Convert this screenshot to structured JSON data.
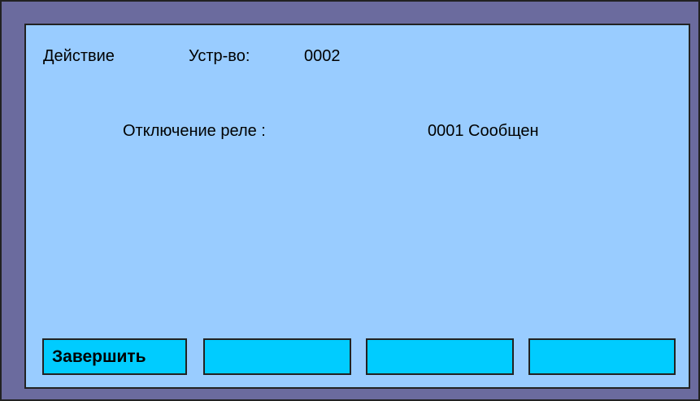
{
  "header": {
    "title": "Действие",
    "device_label": "Устр-во:",
    "device_value": "0002"
  },
  "item": {
    "label": "Отключение реле :",
    "value": "0001 Сообщен"
  },
  "softkeys": [
    {
      "label": "Завершить"
    },
    {
      "label": ""
    },
    {
      "label": ""
    },
    {
      "label": ""
    }
  ],
  "colors": {
    "frame": "#6b6b9e",
    "screen": "#99ccff",
    "softkey": "#00ccff",
    "border": "#222222"
  }
}
